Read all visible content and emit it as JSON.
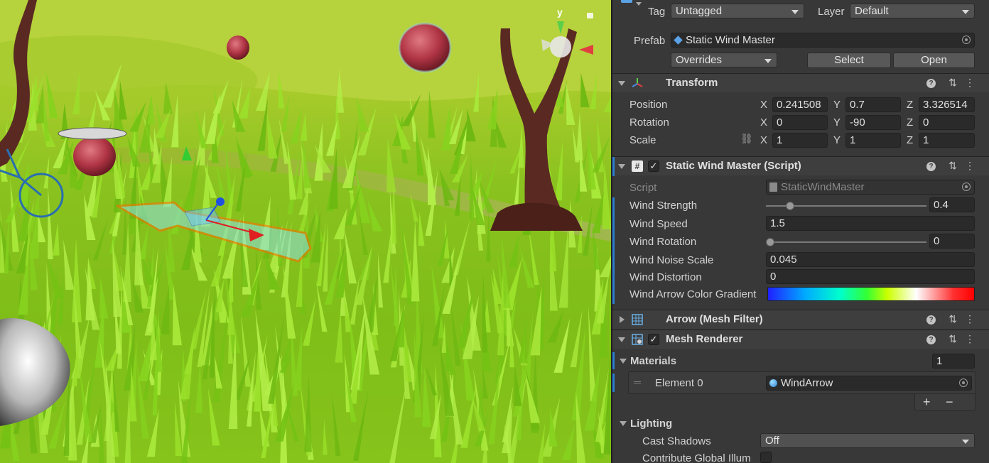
{
  "inspector": {
    "tag_label": "Tag",
    "tag_value": "Untagged",
    "layer_label": "Layer",
    "layer_value": "Default",
    "prefab_label": "Prefab",
    "prefab_value": "Static Wind Master",
    "overrides_label": "Overrides",
    "select_label": "Select",
    "open_label": "Open",
    "transform": {
      "title": "Transform",
      "position_label": "Position",
      "rotation_label": "Rotation",
      "scale_label": "Scale",
      "x": "X",
      "y": "Y",
      "z": "Z",
      "position": [
        "0.241508",
        "0.7",
        "3.326514"
      ],
      "rotation": [
        "0",
        "-90",
        "0"
      ],
      "scale": [
        "1",
        "1",
        "1"
      ]
    },
    "script_component": {
      "title": "Static Wind Master (Script)",
      "script_label": "Script",
      "script_value": "StaticWindMaster",
      "wind_strength_label": "Wind Strength",
      "wind_strength_value": "0.4",
      "wind_strength_fraction": 0.15,
      "wind_speed_label": "Wind Speed",
      "wind_speed_value": "1.5",
      "wind_rotation_label": "Wind Rotation",
      "wind_rotation_value": "0",
      "wind_rotation_fraction": 0.0,
      "wind_noise_label": "Wind Noise Scale",
      "wind_noise_value": "0.045",
      "wind_distortion_label": "Wind Distortion",
      "wind_distortion_value": "0",
      "wind_gradient_label": "Wind Arrow Color Gradient"
    },
    "mesh_filter": {
      "title": "Arrow (Mesh Filter)"
    },
    "mesh_renderer": {
      "title": "Mesh Renderer",
      "materials_label": "Materials",
      "materials_count": "1",
      "element0_label": "Element 0",
      "element0_value": "WindArrow",
      "add_label": "+",
      "remove_label": "−",
      "lighting_label": "Lighting",
      "cast_shadows_label": "Cast Shadows",
      "cast_shadows_value": "Off",
      "contribute_gi_label": "Contribute Global Illum"
    }
  },
  "scene": {
    "gizmo_axis_label": "y"
  },
  "colors": {
    "accent_blue": "#2c7fd0",
    "selection_outline": "#ff6a00",
    "panel_bg": "#383838"
  }
}
